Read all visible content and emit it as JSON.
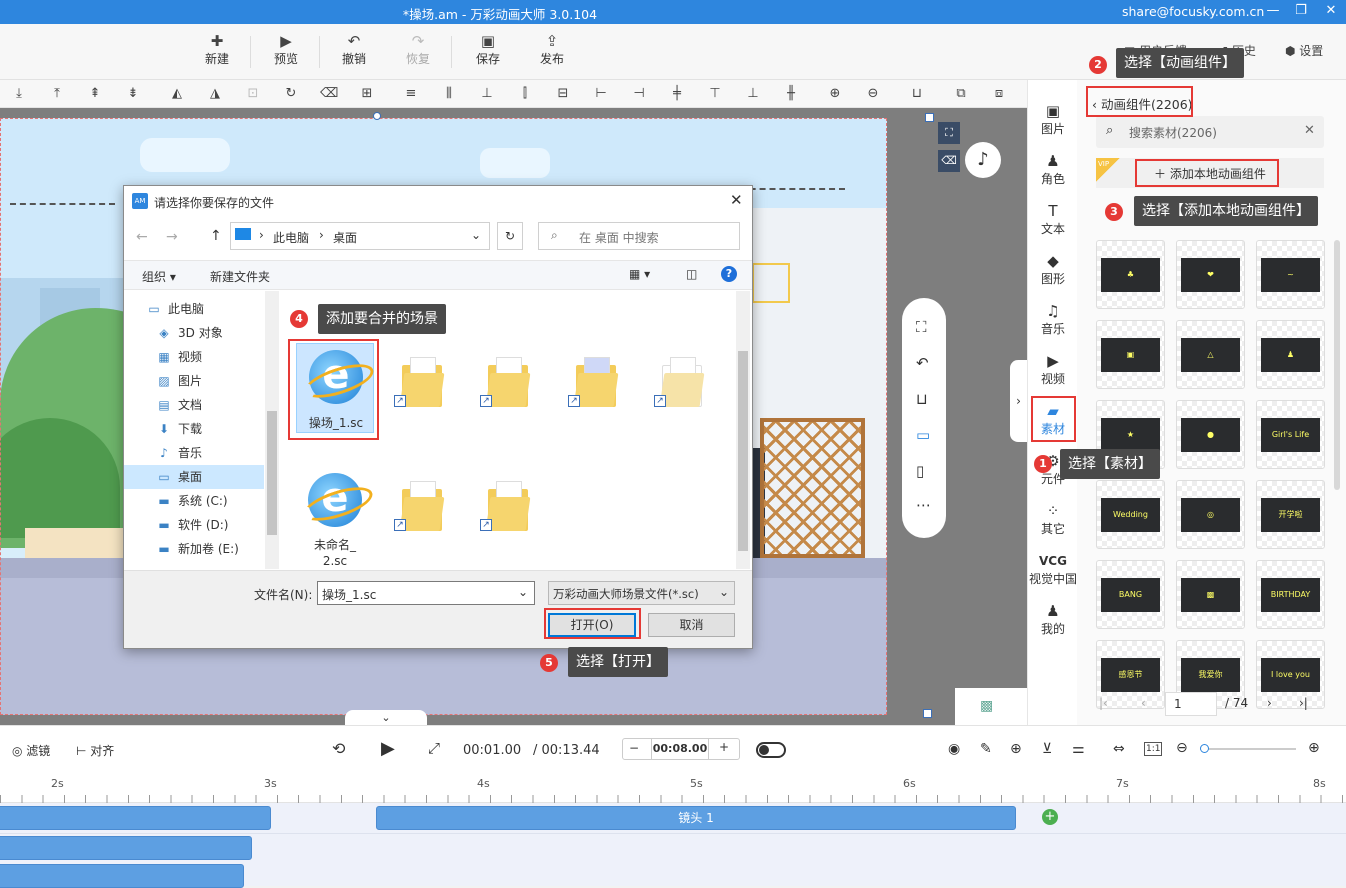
{
  "window": {
    "title": "*操场.am - 万彩动画大师 3.0.104",
    "account": "share@focusky.com.cn",
    "min": "—",
    "restore": "❐",
    "close": "✕"
  },
  "toolbar": {
    "new": {
      "label": "新建",
      "icon": "✚"
    },
    "preview": {
      "label": "预览",
      "icon": "▶"
    },
    "undo": {
      "label": "撤销",
      "icon": "↶"
    },
    "redo": {
      "label": "恢复",
      "icon": "↷"
    },
    "save": {
      "label": "保存",
      "icon": "▣"
    },
    "publish": {
      "label": "发布",
      "icon": "⇪"
    },
    "feedback": "用户反馈",
    "history": "历史",
    "settings": "设置"
  },
  "rail": [
    {
      "label": "图片",
      "icon": "▣"
    },
    {
      "label": "角色",
      "icon": "♟"
    },
    {
      "label": "文本",
      "icon": "T"
    },
    {
      "label": "图形",
      "icon": "◆"
    },
    {
      "label": "音乐",
      "icon": "♫"
    },
    {
      "label": "视频",
      "icon": "▶"
    },
    {
      "label": "素材",
      "icon": "▰"
    },
    {
      "label": "元件",
      "icon": "⚙"
    },
    {
      "label": "其它",
      "icon": "⁘"
    },
    {
      "label": "视觉中国",
      "icon": "VCG"
    },
    {
      "label": "我的",
      "icon": "♟"
    }
  ],
  "panel": {
    "back": "动画组件(2206)",
    "search_placeholder": "搜索素材(2206)",
    "add_local": "添加本地动画组件",
    "vip": "VIP",
    "thumbs": [
      "♣",
      "❤",
      "~",
      "▣",
      "△",
      "♟",
      "★",
      "●",
      "Girl's Life",
      "Wedding",
      "◎",
      "开学啦",
      "BANG",
      "▩",
      "BIRTHDAY",
      "感恩节",
      "我爱你",
      "I love you"
    ],
    "page": "1",
    "total": "/ 74"
  },
  "controls": {
    "filter": "滤镜",
    "align": "对齐",
    "current": "00:01.00",
    "duration": "/ 00:13.44",
    "step": "00:08.00",
    "minus": "−",
    "plus": "+",
    "ratio": "1:1"
  },
  "ruler": [
    "2s",
    "3s",
    "4s",
    "5s",
    "6s",
    "7s",
    "8s"
  ],
  "timeline": {
    "clip_label": "镜头 1"
  },
  "dialog": {
    "title": "请选择你要保存的文件",
    "path": [
      "此电脑",
      "桌面"
    ],
    "search_placeholder": "在 桌面 中搜索",
    "organize": "组织",
    "new_folder": "新建文件夹",
    "tree": [
      {
        "label": "此电脑",
        "icon": "▭"
      },
      {
        "label": "3D 对象",
        "icon": "◈"
      },
      {
        "label": "视频",
        "icon": "▦"
      },
      {
        "label": "图片",
        "icon": "▨"
      },
      {
        "label": "文档",
        "icon": "▤"
      },
      {
        "label": "下载",
        "icon": "⬇"
      },
      {
        "label": "音乐",
        "icon": "♪"
      },
      {
        "label": "桌面",
        "icon": "▭"
      },
      {
        "label": "系统 (C:)",
        "icon": "▬"
      },
      {
        "label": "软件 (D:)",
        "icon": "▬"
      },
      {
        "label": "新加卷 (E:)",
        "icon": "▬"
      }
    ],
    "files": [
      {
        "name": "操场_1.sc"
      },
      {
        "name": "未命名_2.sc"
      }
    ],
    "filename_label": "文件名(N):",
    "filename": "操场_1.sc",
    "filetype": "万彩动画大师场景文件(*.sc)",
    "open": "打开(O)",
    "cancel": "取消"
  },
  "callouts": [
    {
      "n": "1",
      "text": "选择【素材】"
    },
    {
      "n": "2",
      "text": "选择【动画组件】"
    },
    {
      "n": "3",
      "text": "选择【添加本地动画组件】"
    },
    {
      "n": "4",
      "text": "添加要合并的场景"
    },
    {
      "n": "5",
      "text": "选择【打开】"
    }
  ],
  "colors": {
    "accent": "#2e86de",
    "clip": "#5d9fe2",
    "callout": "#4a4a4a",
    "highlight": "#e53935"
  }
}
